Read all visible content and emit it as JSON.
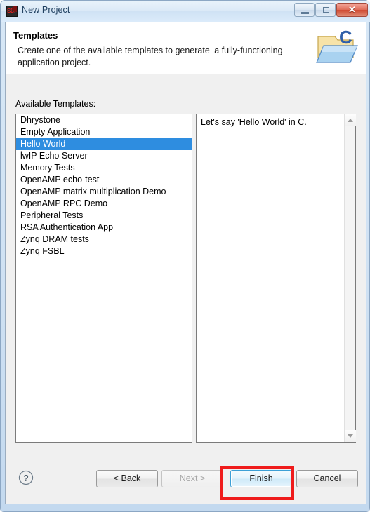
{
  "window": {
    "title": "New Project",
    "app_icon": "sdk-icon",
    "controls": {
      "minimize": "minimize-icon",
      "maximize": "maximize-icon",
      "close": "✕"
    }
  },
  "banner": {
    "title": "Templates",
    "description_before_caret": "Create one of the available templates to generate ",
    "description_after_caret": "a fully-functioning application project.",
    "icon": "folder-c-icon"
  },
  "main": {
    "list_label": "Available Templates:",
    "templates": [
      {
        "label": "Dhrystone",
        "selected": false
      },
      {
        "label": "Empty Application",
        "selected": false
      },
      {
        "label": "Hello World",
        "selected": true
      },
      {
        "label": "lwIP Echo Server",
        "selected": false
      },
      {
        "label": "Memory Tests",
        "selected": false
      },
      {
        "label": "OpenAMP echo-test",
        "selected": false
      },
      {
        "label": "OpenAMP matrix multiplication Demo",
        "selected": false
      },
      {
        "label": "OpenAMP RPC Demo",
        "selected": false
      },
      {
        "label": "Peripheral Tests",
        "selected": false
      },
      {
        "label": "RSA Authentication App",
        "selected": false
      },
      {
        "label": "Zynq DRAM tests",
        "selected": false
      },
      {
        "label": "Zynq FSBL",
        "selected": false
      }
    ],
    "description": "Let's say 'Hello World' in C.",
    "scrollbar": {
      "up_arrow": "scroll-up-icon",
      "down_arrow": "scroll-down-icon"
    }
  },
  "footer": {
    "help": "?",
    "buttons": [
      {
        "id": "back",
        "label": "< Back",
        "state": "enabled"
      },
      {
        "id": "next",
        "label": "Next >",
        "state": "disabled"
      },
      {
        "id": "finish",
        "label": "Finish",
        "state": "focused"
      },
      {
        "id": "cancel",
        "label": "Cancel",
        "state": "enabled"
      }
    ],
    "highlight_color": "#ef1b1b"
  }
}
